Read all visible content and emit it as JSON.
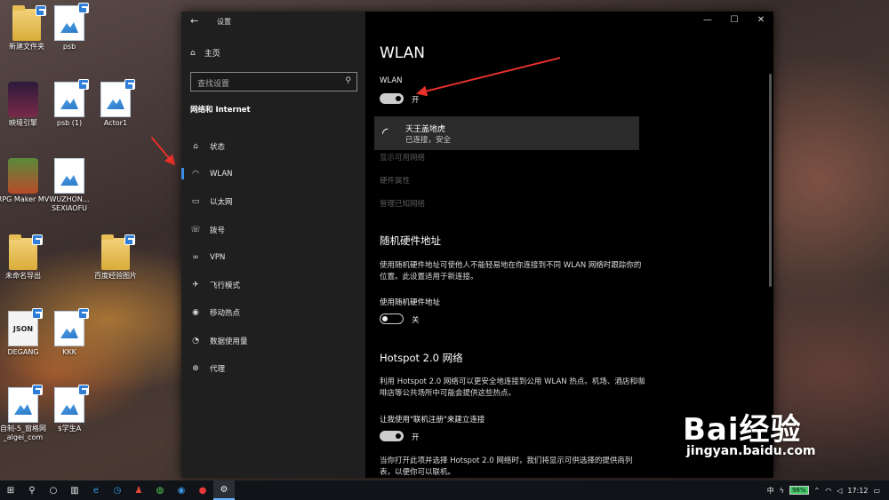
{
  "desktop": {
    "icons": [
      {
        "label": "新建文件夹",
        "icon": "folder-icon"
      },
      {
        "label": "psb",
        "icon": "image-file-icon"
      },
      {
        "label": "映境引擎",
        "icon": "game-app-icon"
      },
      {
        "label": "psb (1)",
        "icon": "image-file-icon"
      },
      {
        "label": "Actor1",
        "icon": "image-file-icon"
      },
      {
        "label": "RPG Maker MV",
        "icon": "rpg-maker-icon"
      },
      {
        "label": "WUZHON... SEXIAOFU",
        "icon": "image-file-icon"
      },
      {
        "label": "未命名导出",
        "icon": "folder-icon"
      },
      {
        "label": "百度经验图片",
        "icon": "folder-icon"
      },
      {
        "label": "DEGANG",
        "icon": "json-file-icon"
      },
      {
        "label": "KKK",
        "icon": "image-file-icon"
      },
      {
        "label": "自制-5_窗格网_algei_com",
        "icon": "image-file-icon"
      },
      {
        "label": "$学生A",
        "icon": "image-file-icon"
      }
    ]
  },
  "window": {
    "title": "设置",
    "back": "←",
    "minimize": "—",
    "maximize": "☐",
    "close": "✕"
  },
  "sidebar": {
    "home": "主页",
    "search_placeholder": "查找设置",
    "section": "网络和 Internet",
    "items": [
      {
        "label": "状态",
        "icon": "globe-status-icon",
        "glyph": "⌂"
      },
      {
        "label": "WLAN",
        "icon": "wifi-icon",
        "glyph": "◠"
      },
      {
        "label": "以太网",
        "icon": "ethernet-icon",
        "glyph": "▭"
      },
      {
        "label": "拨号",
        "icon": "dialup-icon",
        "glyph": "☏"
      },
      {
        "label": "VPN",
        "icon": "vpn-icon",
        "glyph": "∞"
      },
      {
        "label": "飞行模式",
        "icon": "airplane-icon",
        "glyph": "✈"
      },
      {
        "label": "移动热点",
        "icon": "hotspot-icon",
        "glyph": "◉"
      },
      {
        "label": "数据使用量",
        "icon": "data-usage-icon",
        "glyph": "◔"
      },
      {
        "label": "代理",
        "icon": "proxy-icon",
        "glyph": "⊕"
      }
    ],
    "active_index": 1
  },
  "main": {
    "heading": "WLAN",
    "wlan_label": "WLAN",
    "wlan_state": "开",
    "wlan_on": true,
    "network": {
      "name": "天王盖地虎",
      "status": "已连接，安全"
    },
    "links": [
      "显示可用网络",
      "硬件属性",
      "管理已知网络"
    ],
    "random_mac": {
      "heading": "随机硬件地址",
      "desc": "使用随机硬件地址可使他人不能轻易地在你连接到不同 WLAN 网络时跟踪你的位置。此设置适用于新连接。",
      "toggle_label": "使用随机硬件地址",
      "state": "关",
      "on": false
    },
    "hotspot20": {
      "heading": "Hotspot 2.0 网络",
      "desc": "利用 Hotspot 2.0 网络可以更安全地连接到公用 WLAN 热点。机场、酒店和咖啡店等公共场所中可能会提供这些热点。",
      "toggle_label": "让我使用\"联机注册\"来建立连接",
      "state": "开",
      "on": true,
      "footer": "当你打开此项并选择 Hotspot 2.0 网络时，我们将显示可供选择的提供商列表，以便你可以联机。"
    }
  },
  "taskbar": {
    "clock": "17:12",
    "battery": "98%",
    "tray_text": "中",
    "apps": [
      "start-icon",
      "search-icon",
      "cortana-icon",
      "task-view-icon",
      "edge-icon",
      "clock-app-icon",
      "app-icon",
      "wechat-icon",
      "browser-icon",
      "netease-music-icon",
      "settings-icon"
    ]
  },
  "watermark": {
    "brand": "Bai经验",
    "url": "jingyan.baidu.com"
  }
}
